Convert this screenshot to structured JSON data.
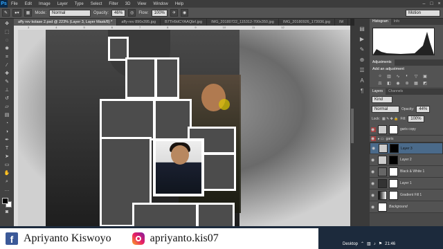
{
  "app": {
    "logo": "Ps"
  },
  "menu": [
    "File",
    "Edit",
    "Image",
    "Layer",
    "Type",
    "Select",
    "Filter",
    "3D",
    "View",
    "Window",
    "Help"
  ],
  "window_controls": [
    "–",
    "□",
    "×"
  ],
  "options": {
    "mode_label": "Mode:",
    "mode_value": "Normal",
    "opacity_label": "Opacity:",
    "opacity_value": "46%",
    "flow_label": "Flow:",
    "flow_value": "100%",
    "workspace": "Motion"
  },
  "tabs": [
    {
      "label": "affy rev kolase 2.psd @ 223% (Layer 3, Layer Mask/8) *",
      "active": true
    },
    {
      "label": "affy-rev 890x395.jpg",
      "active": false
    },
    {
      "label": "B7TH9dCYAAQbrl.jpg",
      "active": false
    },
    {
      "label": "IMG_20180722_115312-700x350.jpg",
      "active": false
    },
    {
      "label": "IMG_20180926_173936.jpg",
      "active": false
    },
    {
      "label": "IM",
      "active": false
    }
  ],
  "ruler_ticks": [
    "3",
    "4",
    "5",
    "6",
    "7",
    "8",
    "9",
    "10",
    "11",
    "12"
  ],
  "panels": {
    "histogram_tab": "Histogram",
    "info_tab": "Info",
    "adjustments_tab": "Adjustments",
    "adjustments_title": "Add an adjustment",
    "layers_tab": "Layers",
    "channels_tab": "Channels",
    "kind_label": "Kind",
    "blend_mode": "Normal",
    "opacity_label": "Opacity:",
    "opacity_value": "44%",
    "lock_label": "Lock:",
    "fill_label": "Fill:",
    "fill_value": "100%"
  },
  "layers": [
    {
      "name": "garis copy",
      "mask": "white"
    },
    {
      "name": "garis",
      "group": true
    },
    {
      "name": "Layer 3",
      "mask": "black",
      "selected": true
    },
    {
      "name": "Layer 2",
      "mask": "black"
    },
    {
      "name": "Black & White 1",
      "mask": "white"
    },
    {
      "name": "Layer 1",
      "mask": "white"
    },
    {
      "name": "Gradient Fill 1",
      "mask": "white"
    },
    {
      "name": "Background",
      "mask": "none"
    }
  ],
  "social": {
    "facebook": "Apriyanto Kiswoyo",
    "instagram": "apriyanto.kis07"
  },
  "taskbar": {
    "desktop": "Desktop",
    "time": "21:46"
  },
  "colors": {
    "accent": "#31a8ff",
    "selected_layer": "#4a6a8a"
  }
}
